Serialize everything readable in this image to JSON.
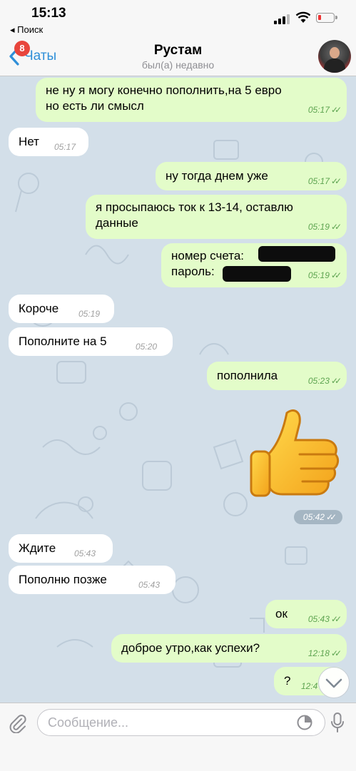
{
  "status_bar": {
    "time": "15:13",
    "back_app": "◂ Поиск"
  },
  "header": {
    "back_label": "Чаты",
    "unread_badge": "8",
    "title": "Рустам",
    "subtitle": "был(а) недавно"
  },
  "messages": [
    {
      "dir": "out",
      "lines": [
        "не ну я могу конечно пополнить,на 5 евро",
        "но есть ли смысл"
      ],
      "time": "05:17"
    },
    {
      "dir": "in",
      "lines": [
        "Нет"
      ],
      "time": "05:17"
    },
    {
      "dir": "out",
      "lines": [
        "ну тогда днем уже"
      ],
      "time": "05:17"
    },
    {
      "dir": "out",
      "lines": [
        "я просыпаюсь ток к 13-14, оставлю",
        "данные"
      ],
      "time": "05:19"
    },
    {
      "dir": "out",
      "lines": [
        "номер счета:",
        "пароль:"
      ],
      "time": "05:19"
    },
    {
      "dir": "in",
      "lines": [
        "Короче"
      ],
      "time": "05:19"
    },
    {
      "dir": "in",
      "lines": [
        "Пополните на 5"
      ],
      "time": "05:20"
    },
    {
      "dir": "out",
      "lines": [
        "пополнила"
      ],
      "time": "05:23"
    },
    {
      "dir": "in",
      "lines": [
        "Ждите"
      ],
      "time": "05:43"
    },
    {
      "dir": "in",
      "lines": [
        "Пополню позже"
      ],
      "time": "05:43"
    },
    {
      "dir": "out",
      "lines": [
        "ок"
      ],
      "time": "05:43"
    },
    {
      "dir": "out",
      "lines": [
        "доброе утро,как успехи?"
      ],
      "time": "12:18"
    },
    {
      "dir": "out",
      "lines": [
        "?"
      ],
      "time": "12:4"
    }
  ],
  "sticker": {
    "icon": "thumbs-up-sticker",
    "time": "05:42"
  },
  "input": {
    "placeholder": "Сообщение..."
  },
  "colors": {
    "accent": "#2f8fd8",
    "outgoing_bubble": "#e3fcc9",
    "incoming_bubble": "#ffffff",
    "chat_bg": "#d3dfe9",
    "badge": "#e8453c"
  }
}
